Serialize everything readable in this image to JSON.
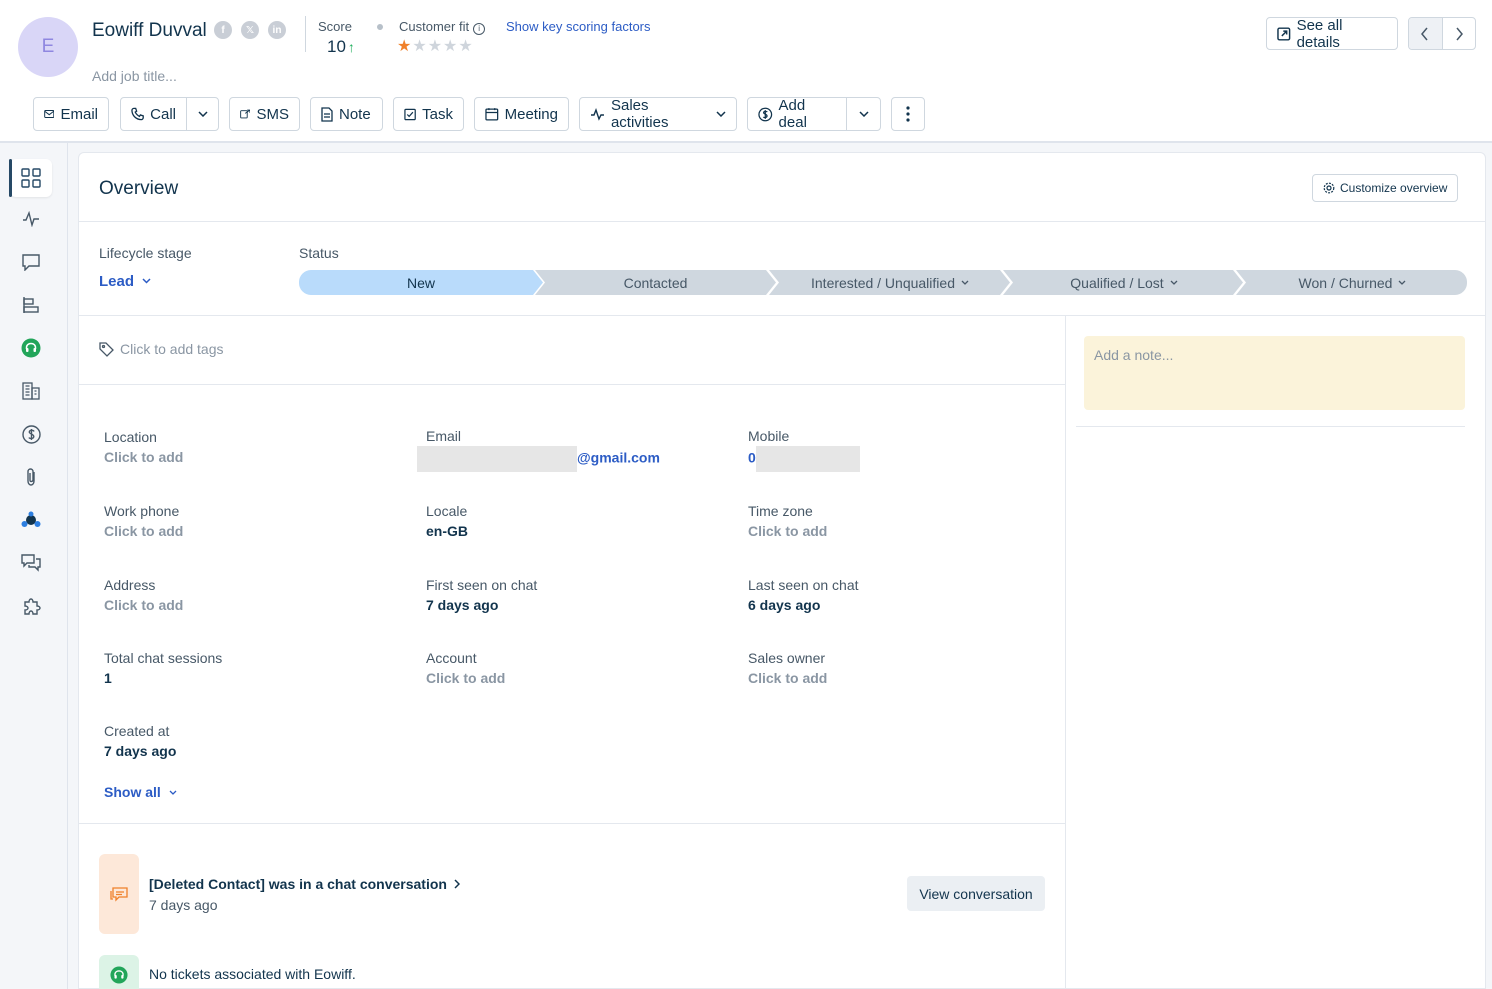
{
  "contact": {
    "initial": "E",
    "name": "Eowiff Duvval",
    "job_title_placeholder": "Add job title...",
    "social": [
      "f",
      "x",
      "in"
    ]
  },
  "score": {
    "label": "Score",
    "value": "10",
    "trend": "up"
  },
  "customer_fit": {
    "label": "Customer fit",
    "stars_filled": 1,
    "stars_total": 5,
    "link": "Show key scoring factors"
  },
  "header_actions": {
    "see_all_details": "See all details"
  },
  "toolbar": {
    "email": "Email",
    "call": "Call",
    "sms": "SMS",
    "note": "Note",
    "task": "Task",
    "meeting": "Meeting",
    "sales_activities": "Sales activities",
    "add_deal": "Add deal"
  },
  "sidebar": {
    "icons": [
      "overview-icon",
      "activity-icon",
      "conversations-icon",
      "timeline-icon",
      "support-icon",
      "accounts-icon",
      "deals-icon",
      "attachments-icon",
      "integrations-icon",
      "chat-icon",
      "apps-icon"
    ]
  },
  "overview": {
    "title": "Overview",
    "customize": "Customize overview",
    "lifecycle_label": "Lifecycle stage",
    "lifecycle_value": "Lead",
    "status_label": "Status",
    "stages": [
      {
        "label": "New",
        "active": true
      },
      {
        "label": "Contacted",
        "active": false
      },
      {
        "label": "Interested / Unqualified",
        "active": false
      },
      {
        "label": "Qualified / Lost",
        "active": false
      },
      {
        "label": "Won / Churned",
        "active": false
      }
    ],
    "tags_placeholder": "Click to add tags",
    "note_placeholder": "Add a note...",
    "fields": {
      "location": {
        "label": "Location",
        "value": "Click to add"
      },
      "email": {
        "label": "Email",
        "value": "@gmail.com"
      },
      "mobile": {
        "label": "Mobile",
        "value": "0"
      },
      "work_phone": {
        "label": "Work phone",
        "value": "Click to add"
      },
      "locale": {
        "label": "Locale",
        "value": "en-GB"
      },
      "time_zone": {
        "label": "Time zone",
        "value": "Click to add"
      },
      "address": {
        "label": "Address",
        "value": "Click to add"
      },
      "first_seen": {
        "label": "First seen on chat",
        "value": "7 days ago"
      },
      "last_seen": {
        "label": "Last seen on chat",
        "value": "6 days ago"
      },
      "total_sessions": {
        "label": "Total chat sessions",
        "value": "1"
      },
      "account": {
        "label": "Account",
        "value": "Click to add"
      },
      "sales_owner": {
        "label": "Sales owner",
        "value": "Click to add"
      },
      "created_at": {
        "label": "Created at",
        "value": "7 days ago"
      }
    },
    "show_all": "Show all"
  },
  "activity": {
    "conversation_title": "[Deleted Contact] was in a chat conversation",
    "conversation_time": "7 days ago",
    "view_conversation": "View conversation",
    "tickets_text": "No tickets associated with Eowiff."
  }
}
